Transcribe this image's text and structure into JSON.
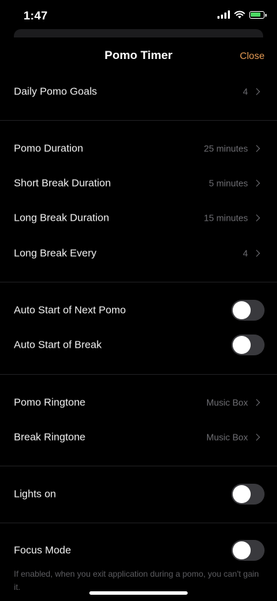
{
  "status_bar": {
    "time": "1:47"
  },
  "header": {
    "title": "Pomo Timer",
    "close_label": "Close"
  },
  "settings": {
    "daily_goals": {
      "label": "Daily Pomo Goals",
      "value": "4"
    },
    "pomo_duration": {
      "label": "Pomo Duration",
      "value": "25 minutes"
    },
    "short_break": {
      "label": "Short Break Duration",
      "value": "5 minutes"
    },
    "long_break": {
      "label": "Long Break Duration",
      "value": "15 minutes"
    },
    "long_break_every": {
      "label": "Long Break Every",
      "value": "4"
    },
    "auto_next_pomo": {
      "label": "Auto Start of Next Pomo",
      "enabled": false
    },
    "auto_break": {
      "label": "Auto Start of Break",
      "enabled": false
    },
    "pomo_ringtone": {
      "label": "Pomo Ringtone",
      "value": "Music Box"
    },
    "break_ringtone": {
      "label": "Break Ringtone",
      "value": "Music Box"
    },
    "lights_on": {
      "label": "Lights on",
      "enabled": false
    },
    "focus_mode": {
      "label": "Focus Mode",
      "enabled": false,
      "description": "If enabled, when you exit application during a pomo, you can't gain it."
    }
  },
  "colors": {
    "background": "#000000",
    "accent": "#e59a54",
    "secondary_text": "#6e6e73",
    "toggle_off": "#39393d",
    "battery_charging": "#4cd964"
  },
  "icons": [
    "signal-icon",
    "wifi-icon",
    "battery-charging-icon",
    "chevron-right-icon"
  ]
}
